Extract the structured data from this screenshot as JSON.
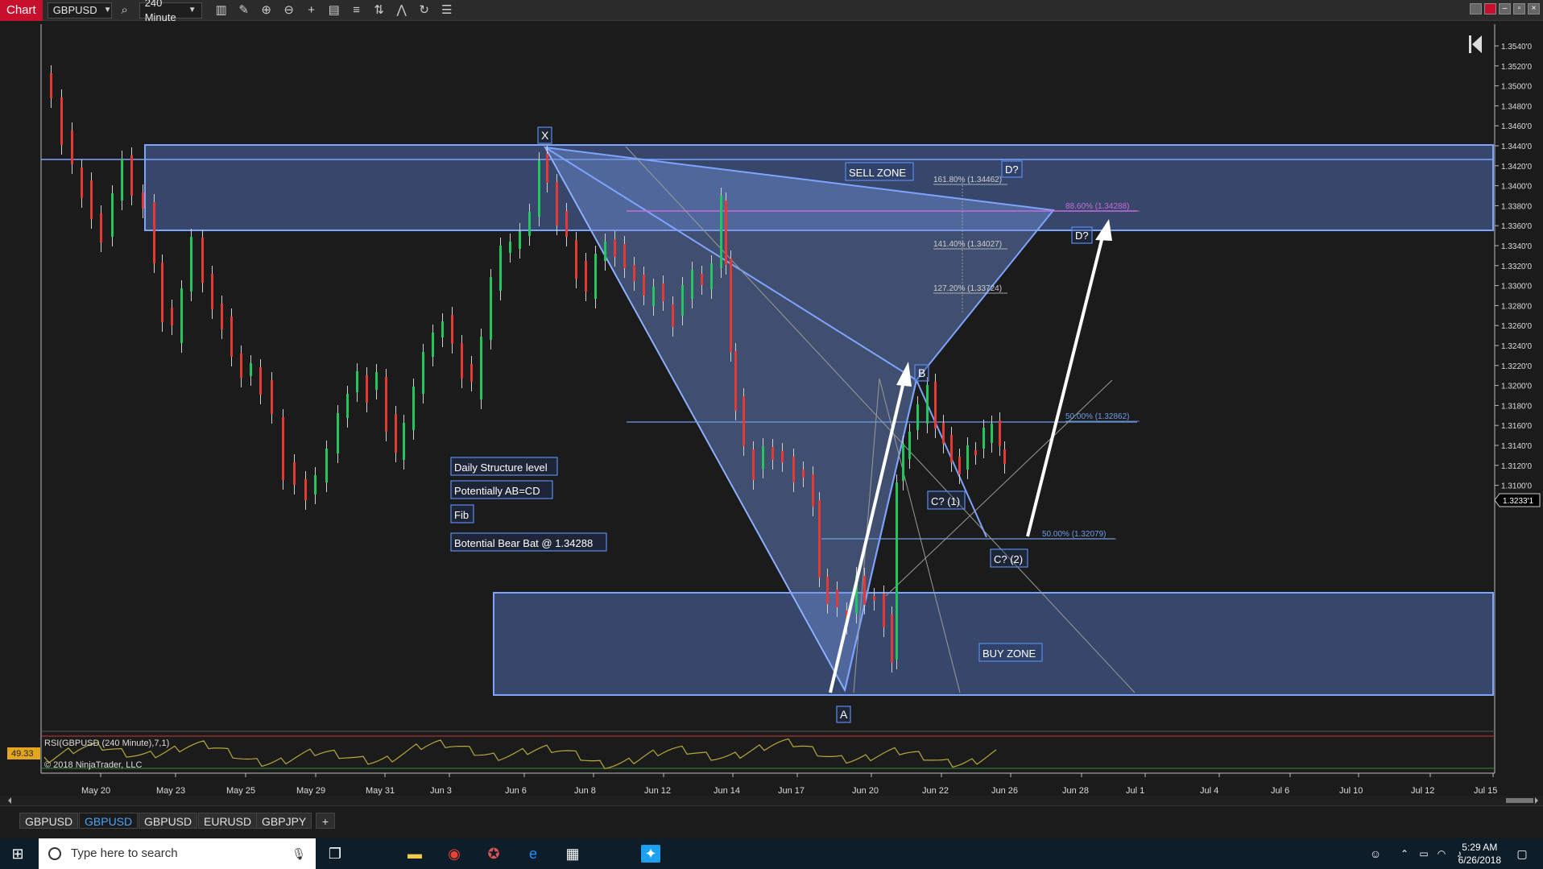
{
  "toolbar": {
    "chart_label": "Chart",
    "instrument": "GBPUSD",
    "timeframe": "240 Minute"
  },
  "chart": {
    "price_labels": [
      "1.3540'0",
      "1.3520'0",
      "1.3500'0",
      "1.3480'0",
      "1.3460'0",
      "1.3440'0",
      "1.3420'0",
      "1.3400'0",
      "1.3380'0",
      "1.3360'0",
      "1.3340'0",
      "1.3320'0",
      "1.3300'0",
      "1.3280'0",
      "1.3260'0",
      "1.3240'0",
      "1.3220'0",
      "1.3200'0",
      "1.3180'0",
      "1.3160'0",
      "1.3140'0",
      "1.3120'0",
      "1.3100'0"
    ],
    "current_price": "1.3233'1",
    "date_labels": [
      "May 20",
      "May 23",
      "May 25",
      "May 29",
      "May 31",
      "Jun 3",
      "Jun 6",
      "Jun 8",
      "Jun 12",
      "Jun 14",
      "Jun 17",
      "Jun 20",
      "Jun 22",
      "Jun 26",
      "Jun 28",
      "Jul 1",
      "Jul 4",
      "Jul 6",
      "Jul 10",
      "Jul 12",
      "Jul 15"
    ],
    "zones": {
      "sell": "SELL ZONE",
      "buy": "BUY ZONE"
    },
    "points": {
      "x": "X",
      "a": "A",
      "b": "B",
      "c1": "C? (1)",
      "c2": "C? (2)",
      "d1": "D?",
      "d2": "D?"
    },
    "fib_levels": [
      "161.80% (1.34462)",
      "141.40% (1.34027)",
      "127.20% (1.33724)",
      "88.60% (1.34288)",
      "50.00% (1.32862)",
      "50.00% (1.32079)"
    ],
    "notes": [
      "Daily Structure level",
      "Potentially  AB=CD",
      "Fib",
      "Botential Bear Bat @ 1.34288"
    ],
    "rsi": {
      "title": "RSI(GBPUSD (240 Minute),7,1)",
      "value": "49.33"
    },
    "copyright": "© 2018 NinjaTrader, LLC",
    "colors": {
      "up": "#22c55e",
      "down": "#e53935",
      "zone": "#6f8fd6",
      "pattern": "#7aa0f0",
      "fib88": "#c86cd8"
    }
  },
  "tabs": [
    "GBPUSD",
    "GBPUSD",
    "GBPUSD",
    "EURUSD",
    "GBPJPY",
    "+"
  ],
  "active_tab": 1,
  "taskbar": {
    "search_placeholder": "Type here to search",
    "time": "5:29 AM",
    "date": "6/26/2018"
  }
}
